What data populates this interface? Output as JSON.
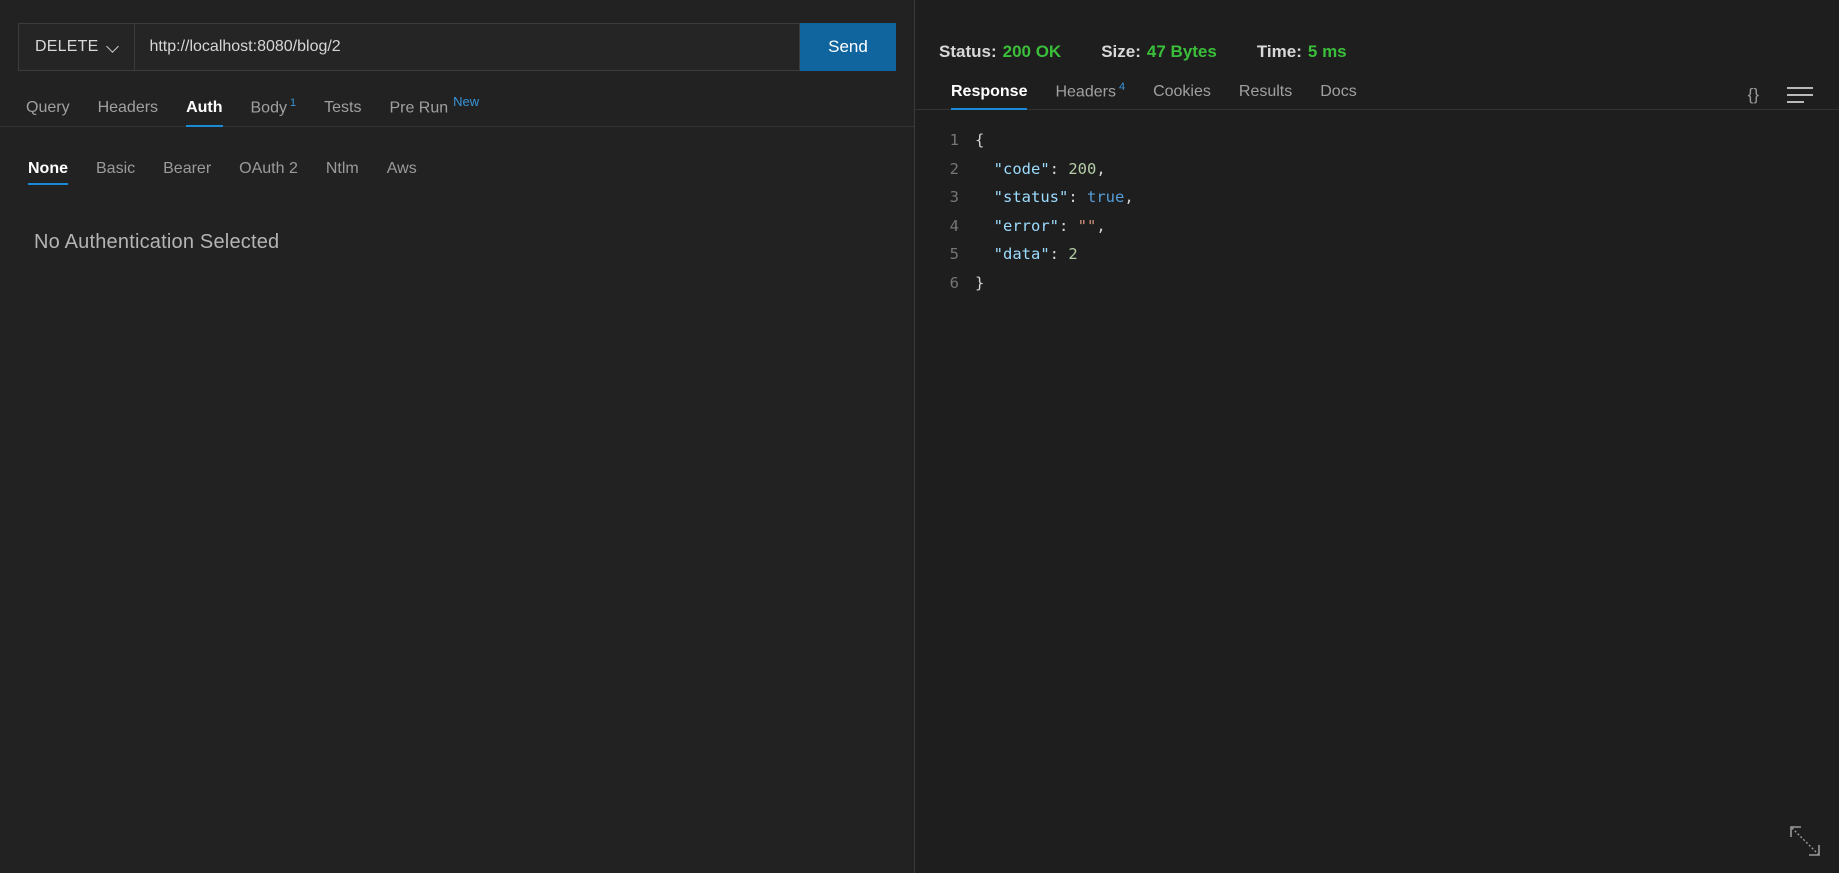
{
  "request": {
    "method": "DELETE",
    "method_caret_icon": "chevron-down-icon",
    "url": "http://localhost:8080/blog/2",
    "url_placeholder": "Enter request URL",
    "send_label": "Send",
    "tabs": [
      {
        "label": "Query",
        "badge": "",
        "active": false
      },
      {
        "label": "Headers",
        "badge": "",
        "active": false
      },
      {
        "label": "Auth",
        "badge": "",
        "active": true
      },
      {
        "label": "Body",
        "badge": "1",
        "active": false
      },
      {
        "label": "Tests",
        "badge": "",
        "active": false
      },
      {
        "label": "Pre Run",
        "badge": "New",
        "active": false
      }
    ]
  },
  "auth": {
    "methods": [
      {
        "label": "None",
        "active": true
      },
      {
        "label": "Basic",
        "active": false
      },
      {
        "label": "Bearer",
        "active": false
      },
      {
        "label": "OAuth 2",
        "active": false
      },
      {
        "label": "Ntlm",
        "active": false
      },
      {
        "label": "Aws",
        "active": false
      }
    ],
    "empty_message": "No Authentication Selected"
  },
  "response": {
    "status_label": "Status:",
    "status_value": "200 OK",
    "size_label": "Size:",
    "size_value": "47 Bytes",
    "time_label": "Time:",
    "time_value": "5 ms",
    "tabs": [
      {
        "label": "Response",
        "badge": "",
        "active": true
      },
      {
        "label": "Headers",
        "badge": "4",
        "active": false
      },
      {
        "label": "Cookies",
        "badge": "",
        "active": false
      },
      {
        "label": "Results",
        "badge": "",
        "active": false
      },
      {
        "label": "Docs",
        "badge": "",
        "active": false
      }
    ],
    "actions": {
      "format_icon_label": "{}",
      "menu_icon": "hamburger-icon"
    },
    "body_lines": [
      {
        "n": "1",
        "tokens": [
          {
            "t": "{",
            "c": "k-punc"
          }
        ]
      },
      {
        "n": "2",
        "tokens": [
          {
            "t": "  ",
            "c": "k-punc"
          },
          {
            "t": "\"code\"",
            "c": "k-key"
          },
          {
            "t": ": ",
            "c": "k-punc"
          },
          {
            "t": "200",
            "c": "k-num"
          },
          {
            "t": ",",
            "c": "k-punc"
          }
        ]
      },
      {
        "n": "3",
        "tokens": [
          {
            "t": "  ",
            "c": "k-punc"
          },
          {
            "t": "\"status\"",
            "c": "k-key"
          },
          {
            "t": ": ",
            "c": "k-punc"
          },
          {
            "t": "true",
            "c": "k-bool"
          },
          {
            "t": ",",
            "c": "k-punc"
          }
        ]
      },
      {
        "n": "4",
        "tokens": [
          {
            "t": "  ",
            "c": "k-punc"
          },
          {
            "t": "\"error\"",
            "c": "k-key"
          },
          {
            "t": ": ",
            "c": "k-punc"
          },
          {
            "t": "\"\"",
            "c": "k-str"
          },
          {
            "t": ",",
            "c": "k-punc"
          }
        ]
      },
      {
        "n": "5",
        "tokens": [
          {
            "t": "  ",
            "c": "k-punc"
          },
          {
            "t": "\"data\"",
            "c": "k-key"
          },
          {
            "t": ": ",
            "c": "k-punc"
          },
          {
            "t": "2",
            "c": "k-num"
          }
        ]
      },
      {
        "n": "6",
        "tokens": [
          {
            "t": "}",
            "c": "k-punc"
          }
        ]
      }
    ],
    "resize_icon": "diagonal-resize-icon"
  },
  "colors": {
    "accent": "#1b8ad6",
    "send_button": "#10659f",
    "success": "#3bbf3b",
    "badge": "#3794d8",
    "panel_bg": "#222222",
    "response_bg": "#1e1e1e"
  }
}
